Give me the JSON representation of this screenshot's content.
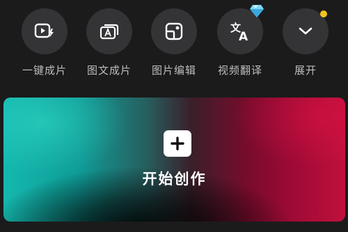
{
  "tools": [
    {
      "label": "一键成片",
      "icon": "play-bolt-icon"
    },
    {
      "label": "图文成片",
      "icon": "stacked-text-a-icon"
    },
    {
      "label": "图片编辑",
      "icon": "image-edit-icon"
    },
    {
      "label": "视频翻译",
      "icon": "translate-icon",
      "badge": "diamond-vip-icon"
    },
    {
      "label": "展开",
      "icon": "chevron-down-icon",
      "badge": "notification-dot"
    }
  ],
  "create": {
    "label": "开始创作",
    "icon": "plus-icon"
  },
  "colors": {
    "background": "#1b1b1c",
    "tool_circle": "#343436",
    "label": "#bdbdbf",
    "card_left": "#14b8ae",
    "card_right": "#c0103c",
    "dot": "#f6c21d"
  }
}
